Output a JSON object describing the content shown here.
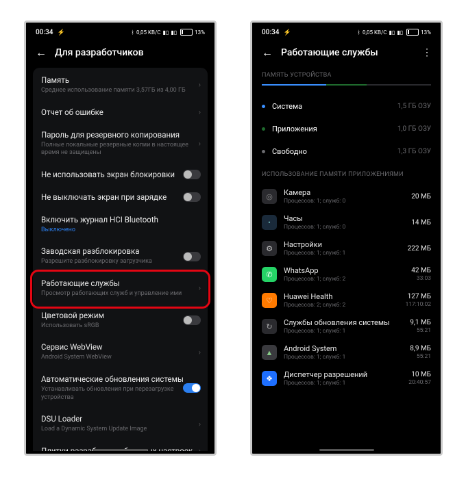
{
  "status": {
    "time": "00:34",
    "battery_pct": "13%",
    "bt_label": "0,05 KB/C"
  },
  "left": {
    "title": "Для разработчиков",
    "rows": [
      {
        "label": "Память",
        "sub": "Среднее использование памяти 3,57ГБ из 4,00 ГБ",
        "kind": "chev"
      },
      {
        "label": "Отчет об ошибке",
        "kind": "chev"
      },
      {
        "label": "Пароль для резервного копирования",
        "sub": "Полные локальные резервные копии в настоящее время не защищены",
        "kind": "chev"
      },
      {
        "label": "Не использовать экран блокировки",
        "kind": "toggle",
        "on": false
      },
      {
        "label": "Не выключать экран при зарядке",
        "kind": "toggle",
        "on": false
      },
      {
        "label": "Включить журнал HCI Bluetooth",
        "sub": "Выключено",
        "sub_blue": true,
        "kind": "none"
      },
      {
        "label": "Заводская разблокировка",
        "sub": "Разрешите разблокировку загрузчика",
        "kind": "toggle",
        "on": false
      },
      {
        "label": "Работающие службы",
        "sub": "Просмотр работающих служб и управление ими",
        "kind": "chev",
        "highlight": true
      },
      {
        "label": "Цветовой режим",
        "sub": "Использовать sRGB",
        "kind": "toggle",
        "on": false
      },
      {
        "label": "Сервис WebView",
        "sub": "Android System WebView",
        "kind": "chev"
      },
      {
        "label": "Автоматические обновления системы",
        "sub": "Устанавливать обновления при перезагрузке устройства",
        "kind": "toggle",
        "on": true
      },
      {
        "label": "DSU Loader",
        "sub": "Load a Dynamic System Update Image",
        "kind": "chev"
      },
      {
        "label": "Плитки разработчика быстрых настроек",
        "kind": "chev"
      }
    ]
  },
  "right": {
    "title": "Работающие службы",
    "mem_section": "ПАМЯТЬ УСТРОЙСТВА",
    "mem_lines": [
      {
        "dot": "#3a8fff",
        "label": "Система",
        "val": "1,5 ГБ ОЗУ"
      },
      {
        "dot": "#1f6b2e",
        "label": "Приложения",
        "val": "1,0 ГБ ОЗУ"
      },
      {
        "dot": "#6a6a6e",
        "label": "Свободно",
        "val": "1,3 ГБ ОЗУ"
      }
    ],
    "apps_section": "ИСПОЛЬЗОВАНИЕ ПАМЯТИ ПРИЛОЖЕНИЯМИ",
    "apps": [
      {
        "name": "Камера",
        "sub": "Процессов: 1; служб: 0",
        "val": "20 МБ",
        "icon_bg": "#2a2a2e",
        "icon_fg": "#888",
        "glyph": "◎"
      },
      {
        "name": "Часы",
        "sub": "Процессов: 1; служб: 0",
        "val": "14 МБ",
        "icon_bg": "#1a2a3a",
        "icon_fg": "#6aa",
        "glyph": "•"
      },
      {
        "name": "Настройки",
        "sub": "Процессов: 1; служб: 1",
        "val": "222 МБ",
        "icon_bg": "#2a2a2e",
        "icon_fg": "#ccc",
        "glyph": "⚙"
      },
      {
        "name": "WhatsApp",
        "sub": "Процессов: 1; служб: 2",
        "val": "42 МБ",
        "val2": "33:03",
        "icon_bg": "#25d366",
        "icon_fg": "#fff",
        "glyph": "✆"
      },
      {
        "name": "Huawei Health",
        "sub": "Процессов: 2; служб: 2",
        "val": "127 МБ",
        "val2": "117:10:02",
        "icon_bg": "#ff7a00",
        "icon_fg": "#fff",
        "glyph": "♡"
      },
      {
        "name": "Службы обновления системы",
        "sub": "Процессов: 1; служб: 1",
        "val": "9,1 МБ",
        "val2": "55:21",
        "icon_bg": "#2a2a2e",
        "icon_fg": "#aaa",
        "glyph": "↻"
      },
      {
        "name": "Android System",
        "sub": "Процессов: 1; служб: 1",
        "val": "8,9 МБ",
        "val2": "55:21",
        "icon_bg": "#3a3a3e",
        "icon_fg": "#8c8",
        "glyph": "▲"
      },
      {
        "name": "Диспетчер разрешений",
        "sub": "Процессов: 1; служб: 1",
        "val": "10 МБ",
        "val2": "20:40:57",
        "icon_bg": "#1e6fff",
        "icon_fg": "#fff",
        "glyph": "❖"
      }
    ]
  }
}
